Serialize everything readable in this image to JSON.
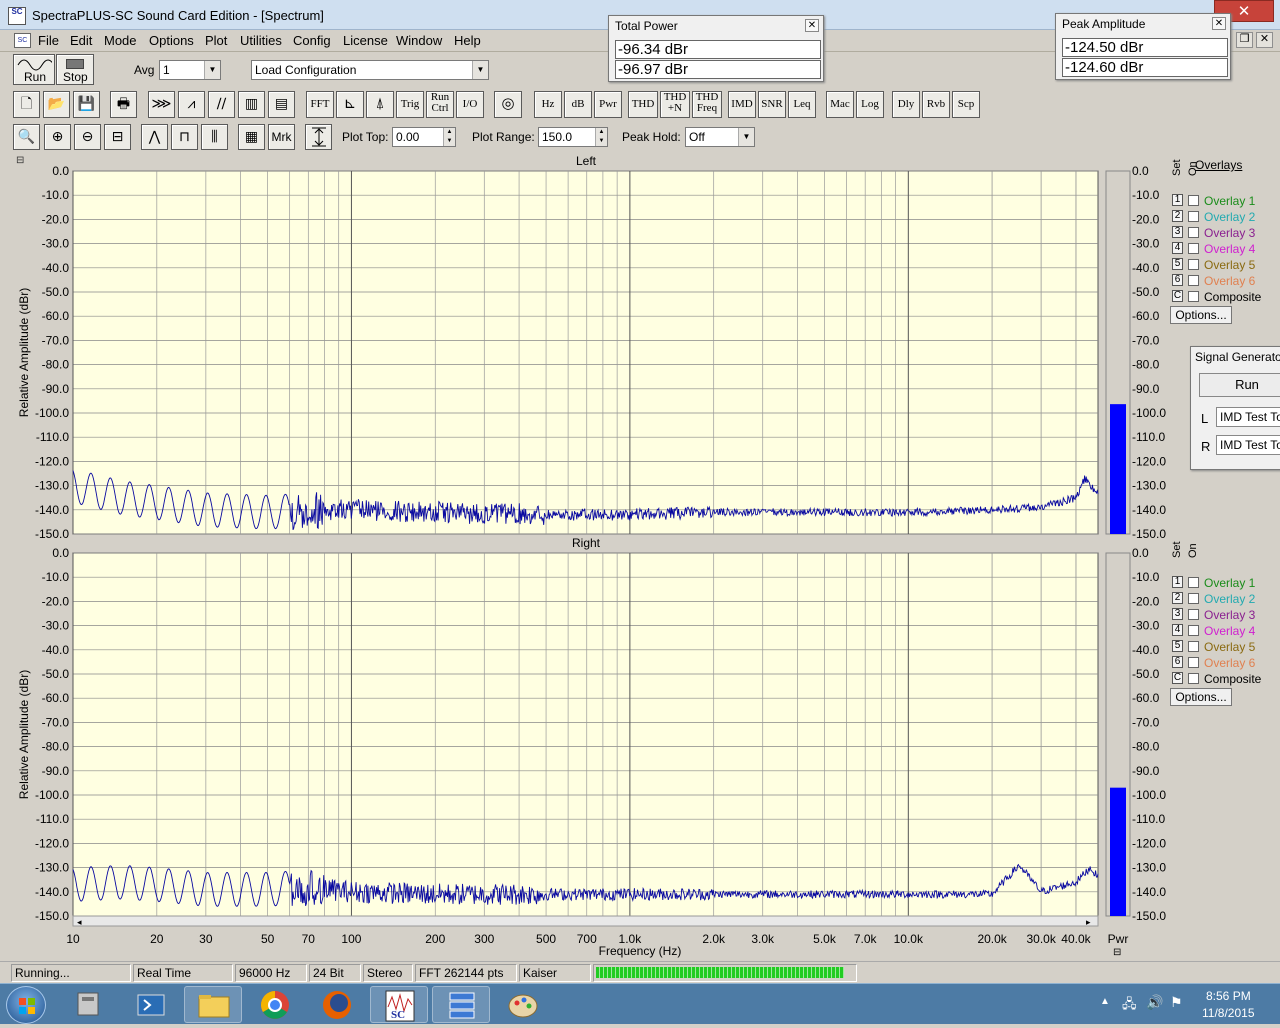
{
  "window": {
    "title": "SpectraPLUS-SC Sound Card Edition - [Spectrum]",
    "app_icon_text": "SC",
    "close_glyph": "✕"
  },
  "menu": [
    "File",
    "Edit",
    "Mode",
    "Options",
    "Plot",
    "Utilities",
    "Config",
    "License",
    "Window",
    "Help"
  ],
  "toolbar1": {
    "run_label": "Run",
    "stop_label": "Stop",
    "avg_label": "Avg",
    "avg_value": "1",
    "config_value": "Load Configuration"
  },
  "toolbar2": {
    "buttons": [
      "new-icon",
      "open-icon",
      "save-icon",
      "print-icon",
      "triggered-icon",
      "average-icon",
      "ramp-icon",
      "spectrogram-icon",
      "3d-surface-icon"
    ],
    "mode_buttons": [
      "FFT",
      "",
      "",
      "Trig",
      "Run Ctrl",
      "I/O",
      "",
      "Hz",
      "dB",
      "Pwr",
      "THD",
      "THD +N",
      "THD Freq",
      "IMD",
      "SNR",
      "Leq",
      "Mac",
      "Log",
      "Dly",
      "Rvb",
      "Scp"
    ]
  },
  "toolbar3": {
    "zoom_buttons": [
      "zoom-icon",
      "zoom-in-2x-icon",
      "zoom-out-2x-icon",
      "zoom-out-full-icon",
      "peak-icon",
      "step-icon",
      "bars-icon",
      "grid-icon"
    ],
    "mrk_label": "Mrk",
    "plot_top_label": "Plot Top:",
    "plot_top_value": "0.00",
    "plot_range_label": "Plot Range:",
    "plot_range_value": "150.0",
    "peak_hold_label": "Peak Hold:",
    "peak_hold_value": "Off"
  },
  "total_power": {
    "title": "Total Power",
    "left": "-96.34 dBr",
    "right": "-96.97 dBr"
  },
  "peak_amplitude": {
    "title": "Peak Amplitude",
    "left": "-124.50 dBr",
    "right": "-124.60 dBr"
  },
  "signal_generator": {
    "title": "Signal Generator",
    "run_label": "Run",
    "l_label": "L",
    "r_label": "R",
    "l_value": "IMD Test Tone",
    "r_value": "IMD Test Tone"
  },
  "overlays": {
    "header": "Overlays",
    "set_label": "Set",
    "on_label": "On",
    "items": [
      {
        "num": "1",
        "label": "Overlay 1",
        "color": "#1a8c1a"
      },
      {
        "num": "2",
        "label": "Overlay 2",
        "color": "#22aab0"
      },
      {
        "num": "3",
        "label": "Overlay 3",
        "color": "#8a2090"
      },
      {
        "num": "4",
        "label": "Overlay 4",
        "color": "#d020d0"
      },
      {
        "num": "5",
        "label": "Overlay 5",
        "color": "#8a6a10"
      },
      {
        "num": "6",
        "label": "Overlay 6",
        "color": "#e08050"
      },
      {
        "num": "C",
        "label": "Composite",
        "color": "#000000"
      }
    ],
    "options_label": "Options..."
  },
  "plots": {
    "left_title": "Left",
    "right_title": "Right",
    "ylabel": "Relative Amplitude (dBr)",
    "xlabel": "Frequency (Hz)",
    "pwr_label": "Pwr",
    "yticks": [
      "0.0",
      "-10.0",
      "-20.0",
      "-30.0",
      "-40.0",
      "-50.0",
      "-60.0",
      "-70.0",
      "-80.0",
      "-90.0",
      "-100.0",
      "-110.0",
      "-120.0",
      "-130.0",
      "-140.0",
      "-150.0"
    ],
    "xticks": [
      {
        "v": 10,
        "t": "10"
      },
      {
        "v": 20,
        "t": "20"
      },
      {
        "v": 30,
        "t": "30"
      },
      {
        "v": 50,
        "t": "50"
      },
      {
        "v": 70,
        "t": "70"
      },
      {
        "v": 100,
        "t": "100"
      },
      {
        "v": 200,
        "t": "200"
      },
      {
        "v": 300,
        "t": "300"
      },
      {
        "v": 500,
        "t": "500"
      },
      {
        "v": 700,
        "t": "700"
      },
      {
        "v": 1000,
        "t": "1.0k"
      },
      {
        "v": 2000,
        "t": "2.0k"
      },
      {
        "v": 3000,
        "t": "3.0k"
      },
      {
        "v": 5000,
        "t": "5.0k"
      },
      {
        "v": 7000,
        "t": "7.0k"
      },
      {
        "v": 10000,
        "t": "10.0k"
      },
      {
        "v": 20000,
        "t": "20.0k"
      },
      {
        "v": 30000,
        "t": "30.0k"
      },
      {
        "v": 40000,
        "t": "40.0k"
      }
    ],
    "plot_bg": "#ffffe1",
    "trace_color": "#0a0aa0",
    "bar_color": "#0000ff"
  },
  "chart_data": {
    "type": "line",
    "xlabel": "Frequency (Hz)",
    "ylabel": "Relative Amplitude (dBr)",
    "xscale": "log",
    "xlim": [
      10,
      48000
    ],
    "ylim": [
      -150,
      0
    ],
    "grid": true,
    "series": [
      {
        "name": "Left",
        "x": [
          10,
          15,
          20,
          30,
          50,
          70,
          100,
          200,
          500,
          1000,
          2000,
          5000,
          10000,
          20000,
          30000,
          40000,
          43000,
          48000
        ],
        "y": [
          -130,
          -135,
          -137,
          -140,
          -141,
          -140,
          -140,
          -141,
          -142,
          -142,
          -141,
          -141,
          -141,
          -140,
          -139,
          -135,
          -127,
          -134
        ],
        "pwr_dBr": -96.34
      },
      {
        "name": "Right",
        "x": [
          10,
          15,
          20,
          30,
          50,
          70,
          100,
          200,
          500,
          1000,
          2000,
          5000,
          10000,
          20000,
          25000,
          30000,
          40000,
          45000,
          48000
        ],
        "y": [
          -137,
          -136,
          -137,
          -139,
          -139,
          -138,
          -140,
          -141,
          -141,
          -141,
          -141,
          -141,
          -141,
          -141,
          -129,
          -140,
          -136,
          -130,
          -134
        ],
        "pwr_dBr": -96.97
      }
    ]
  },
  "status": {
    "state": "Running...",
    "mode": "Real Time",
    "rate": "96000 Hz",
    "bits": "24 Bit",
    "channels": "Stereo",
    "fft": "FFT 262144 pts",
    "window": "Kaiser",
    "progress": 0.96,
    "progress_color": "#22cc22"
  },
  "taskbar": {
    "time": "8:56 PM",
    "date": "11/8/2015",
    "apps": [
      "start-orb-icon",
      "device-manager-icon",
      "powershell-icon",
      "explorer-icon",
      "chrome-icon",
      "firefox-icon",
      "spectraplus-icon",
      "server-stack-icon",
      "paint-icon"
    ]
  }
}
